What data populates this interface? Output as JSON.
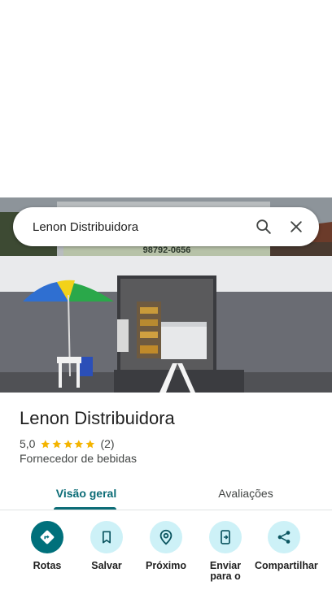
{
  "search": {
    "query": "Lenon Distribuidora",
    "search_icon": "search-icon",
    "close_icon": "close-icon"
  },
  "photo": {
    "sign_text": "98792-0656"
  },
  "place": {
    "name": "Lenon Distribuidora",
    "rating": "5,0",
    "stars": 5,
    "review_count": "(2)",
    "category": "Fornecedor de bebidas",
    "star_color": "#f4b400"
  },
  "tabs": [
    {
      "label": "Visão geral",
      "active": true
    },
    {
      "label": "Avaliações",
      "active": false
    }
  ],
  "actions": [
    {
      "label": "Rotas",
      "icon": "directions-icon"
    },
    {
      "label": "Salvar",
      "icon": "bookmark-icon"
    },
    {
      "label": "Próximo",
      "icon": "nearby-icon"
    },
    {
      "label": "Enviar para o",
      "icon": "send-to-phone-icon"
    },
    {
      "label": "Compartilhar",
      "icon": "share-icon"
    }
  ],
  "colors": {
    "accent": "#0b6c76",
    "action_bg": "#cdf1f7",
    "primary_action": "#00707b"
  }
}
